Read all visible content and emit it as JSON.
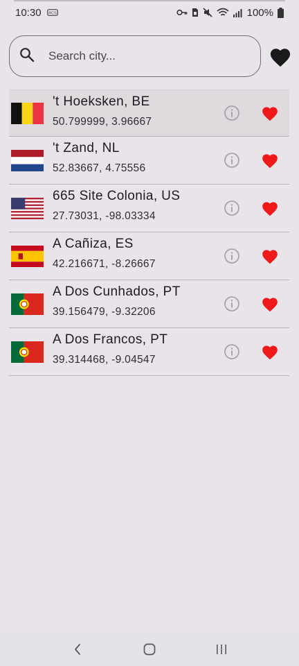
{
  "status_bar": {
    "time": "10:30",
    "battery_percent": "100%",
    "icons": [
      "key-icon",
      "sim-icon",
      "mute-icon",
      "wifi-icon",
      "signal-icon",
      "battery-icon"
    ]
  },
  "search": {
    "placeholder": "Search city...",
    "value": ""
  },
  "colors": {
    "background": "#e9e3ea",
    "heart": "#f01919",
    "selected_row": "#dedade"
  },
  "cities": [
    {
      "name": "'t Hoeksken, BE",
      "coords": "50.799999, 3.96667",
      "flag": "belgium-flag",
      "favorite": true
    },
    {
      "name": "'t Zand, NL",
      "coords": "52.83667, 4.75556",
      "flag": "netherlands-flag",
      "favorite": true
    },
    {
      "name": "665 Site Colonia, US",
      "coords": "27.73031, -98.03334",
      "flag": "usa-flag",
      "favorite": true
    },
    {
      "name": "A Cañiza, ES",
      "coords": "42.216671, -8.26667",
      "flag": "spain-flag",
      "favorite": true
    },
    {
      "name": "A Dos Cunhados, PT",
      "coords": "39.156479, -9.32206",
      "flag": "portugal-flag",
      "favorite": true
    },
    {
      "name": "A Dos Francos, PT",
      "coords": "39.314468, -9.04547",
      "flag": "portugal-flag",
      "favorite": true
    }
  ],
  "nav_bar": {
    "buttons": [
      "back-icon",
      "home-icon",
      "recents-icon"
    ]
  }
}
